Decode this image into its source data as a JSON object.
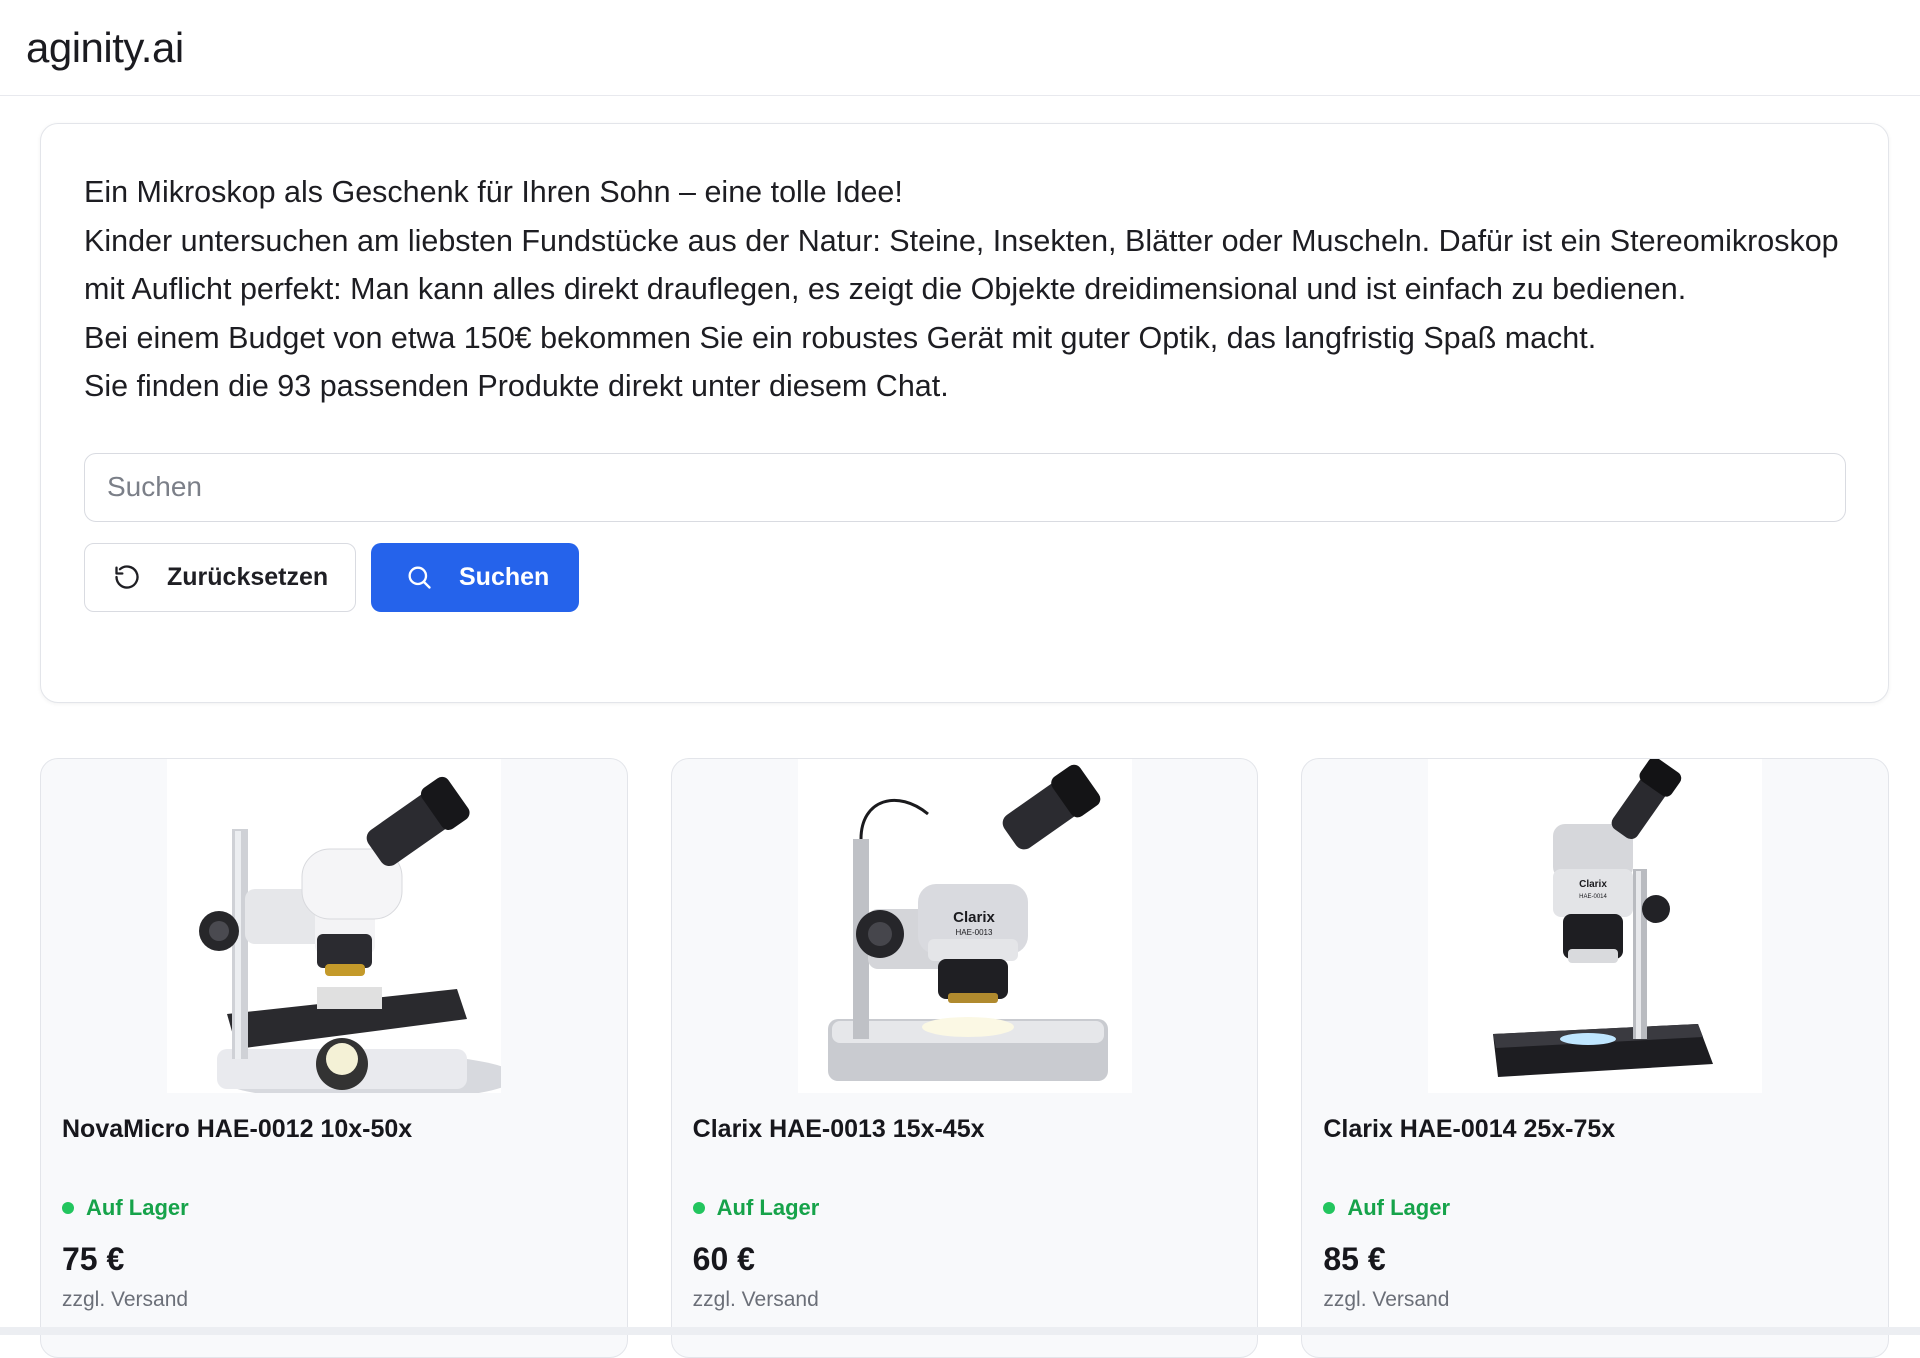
{
  "header": {
    "logo": "aginity.ai"
  },
  "chat": {
    "lines": [
      "Ein Mikroskop als Geschenk für Ihren Sohn – eine tolle Idee!",
      "Kinder untersuchen am liebsten Fundstücke aus der Natur: Steine, Insekten, Blätter oder Muscheln. Dafür ist ein Stereomikroskop mit Auflicht perfekt: Man kann alles direkt drauflegen, es zeigt die Objekte dreidimensional und ist einfach zu bedienen.",
      "Bei einem Budget von etwa 150€ bekommen Sie ein robustes Gerät mit guter Optik, das langfristig Spaß macht.",
      "Sie finden die 93 passenden Produkte direkt unter diesem Chat."
    ],
    "search": {
      "placeholder": "Suchen",
      "value": ""
    },
    "reset_label": "Zurücksetzen",
    "search_label": "Suchen",
    "accent_color": "#2563eb"
  },
  "products": [
    {
      "title": "NovaMicro HAE-0012 10x-50x",
      "stock": "Auf Lager",
      "price": "75 €",
      "shipping": "zzgl. Versand"
    },
    {
      "title": "Clarix HAE-0013 15x-45x",
      "stock": "Auf Lager",
      "price": "60 €",
      "shipping": "zzgl. Versand",
      "image_brand": "Clarix",
      "image_model": "HAE-0013"
    },
    {
      "title": "Clarix HAE-0014 25x-75x",
      "stock": "Auf Lager",
      "price": "85 €",
      "shipping": "zzgl. Versand",
      "image_brand": "Clarix",
      "image_model": "HAE-0014"
    }
  ],
  "status_color": "#16a34a"
}
